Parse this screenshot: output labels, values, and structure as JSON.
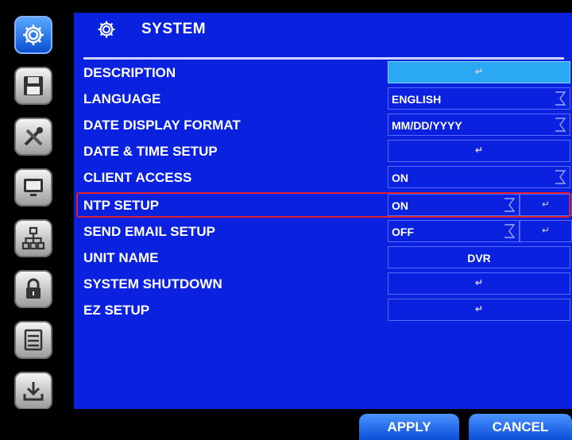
{
  "title": "SYSTEM",
  "menu": [
    {
      "label": "DESCRIPTION",
      "control": "button",
      "value": "↵",
      "highlight": true
    },
    {
      "label": "LANGUAGE",
      "control": "dropdown",
      "value": "ENGLISH"
    },
    {
      "label": "DATE DISPLAY FORMAT",
      "control": "dropdown",
      "value": "MM/DD/YYYY"
    },
    {
      "label": "DATE & TIME SETUP",
      "control": "button",
      "value": "↵"
    },
    {
      "label": "CLIENT ACCESS",
      "control": "dropdown",
      "value": "ON"
    },
    {
      "label": "NTP SETUP",
      "control": "dropdown+button",
      "value": "ON",
      "button": "↵",
      "selected": true
    },
    {
      "label": "SEND EMAIL SETUP",
      "control": "dropdown+button",
      "value": "OFF",
      "button": "↵"
    },
    {
      "label": "UNIT NAME",
      "control": "text",
      "value": "DVR"
    },
    {
      "label": "SYSTEM SHUTDOWN",
      "control": "button",
      "value": "↵"
    },
    {
      "label": "EZ SETUP",
      "control": "button",
      "value": "↵"
    }
  ],
  "buttons": {
    "apply": "APPLY",
    "cancel": "CANCEL"
  },
  "colors": {
    "panel": "#0a22e0",
    "highlight": "#2aa8f2",
    "selection": "#e0202a"
  },
  "sidebar_icons": [
    "gear-icon",
    "floppy-disk-icon",
    "tools-icon",
    "monitor-icon",
    "network-icon",
    "lock-icon",
    "storage-icon",
    "download-icon"
  ]
}
